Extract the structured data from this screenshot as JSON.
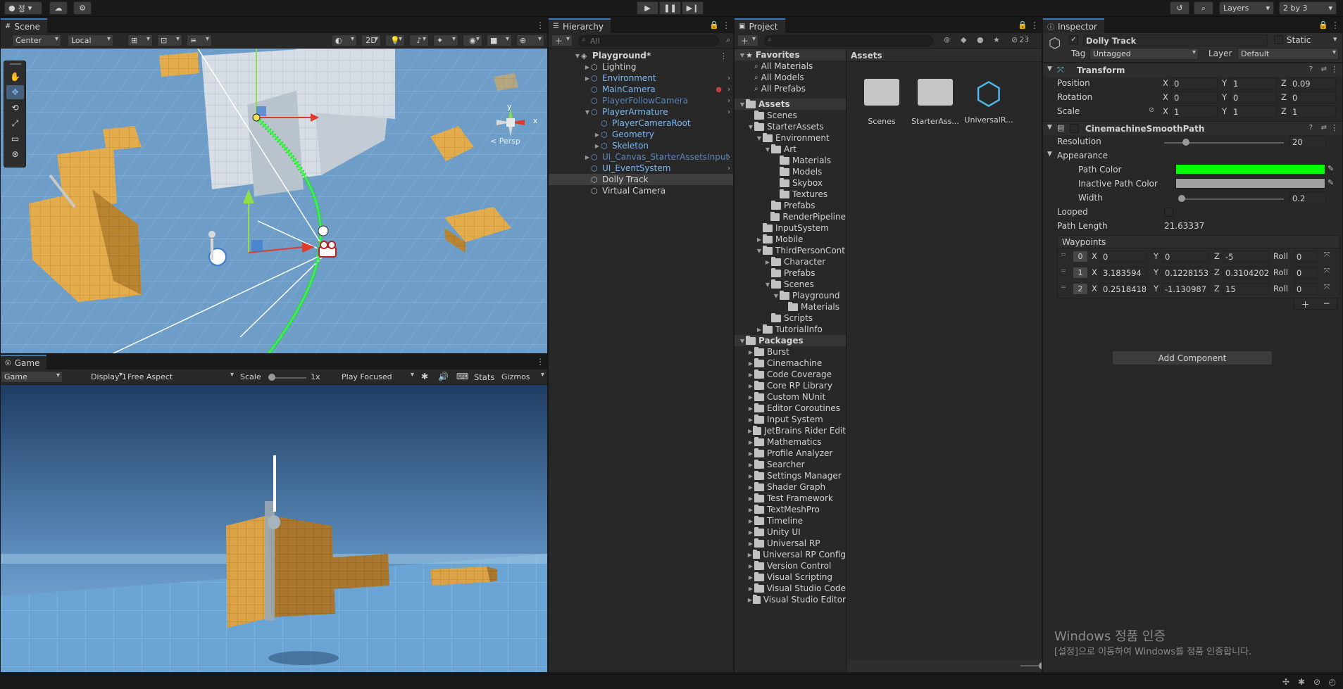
{
  "toolbar": {
    "account": "정",
    "layers": "Layers",
    "layout": "2 by 3"
  },
  "scene": {
    "tab": "Scene",
    "pivot": "Center",
    "space": "Local",
    "mode2d": "2D",
    "persp": "< Persp",
    "axis_y": "y",
    "axis_x": "x"
  },
  "game": {
    "tab": "Game",
    "mode": "Game",
    "display": "Display 1",
    "aspect": "Free Aspect",
    "scale_label": "Scale",
    "scale_value": "1x",
    "play_mode": "Play Focused",
    "stats": "Stats",
    "gizmos": "Gizmos"
  },
  "hierarchy": {
    "tab": "Hierarchy",
    "search_placeholder": "All",
    "items": [
      {
        "label": "Playground*",
        "indent": 0,
        "arrow": "▼",
        "style": "bold"
      },
      {
        "label": "Lighting",
        "indent": 1,
        "arrow": "▶",
        "style": "normal"
      },
      {
        "label": "Environment",
        "indent": 1,
        "arrow": "▶",
        "style": "blue"
      },
      {
        "label": "MainCamera",
        "indent": 1,
        "arrow": "",
        "style": "blue"
      },
      {
        "label": "PlayerFollowCamera",
        "indent": 1,
        "arrow": "",
        "style": "dim"
      },
      {
        "label": "PlayerArmature",
        "indent": 1,
        "arrow": "▼",
        "style": "blue"
      },
      {
        "label": "PlayerCameraRoot",
        "indent": 2,
        "arrow": "",
        "style": "blue"
      },
      {
        "label": "Geometry",
        "indent": 2,
        "arrow": "▶",
        "style": "blue"
      },
      {
        "label": "Skeleton",
        "indent": 2,
        "arrow": "▶",
        "style": "blue"
      },
      {
        "label": "UI_Canvas_StarterAssetsInput",
        "indent": 1,
        "arrow": "▶",
        "style": "dim"
      },
      {
        "label": "UI_EventSystem",
        "indent": 1,
        "arrow": "",
        "style": "blue"
      },
      {
        "label": "Dolly Track",
        "indent": 1,
        "arrow": "",
        "style": "selected"
      },
      {
        "label": "Virtual Camera",
        "indent": 1,
        "arrow": "",
        "style": "normal"
      }
    ]
  },
  "project": {
    "tab": "Project",
    "badge": "23",
    "favorites_label": "Favorites",
    "favorites": [
      "All Materials",
      "All Models",
      "All Prefabs"
    ],
    "assets_label": "Assets",
    "tree": [
      {
        "label": "Scenes",
        "indent": 1,
        "arrow": ""
      },
      {
        "label": "StarterAssets",
        "indent": 1,
        "arrow": "▼"
      },
      {
        "label": "Environment",
        "indent": 2,
        "arrow": "▼"
      },
      {
        "label": "Art",
        "indent": 3,
        "arrow": "▼"
      },
      {
        "label": "Materials",
        "indent": 4,
        "arrow": ""
      },
      {
        "label": "Models",
        "indent": 4,
        "arrow": ""
      },
      {
        "label": "Skybox",
        "indent": 4,
        "arrow": ""
      },
      {
        "label": "Textures",
        "indent": 4,
        "arrow": ""
      },
      {
        "label": "Prefabs",
        "indent": 3,
        "arrow": ""
      },
      {
        "label": "RenderPipeline",
        "indent": 3,
        "arrow": ""
      },
      {
        "label": "InputSystem",
        "indent": 2,
        "arrow": ""
      },
      {
        "label": "Mobile",
        "indent": 2,
        "arrow": "▶"
      },
      {
        "label": "ThirdPersonCont",
        "indent": 2,
        "arrow": "▼"
      },
      {
        "label": "Character",
        "indent": 3,
        "arrow": "▶"
      },
      {
        "label": "Prefabs",
        "indent": 3,
        "arrow": ""
      },
      {
        "label": "Scenes",
        "indent": 3,
        "arrow": "▼"
      },
      {
        "label": "Playground",
        "indent": 4,
        "arrow": "▼"
      },
      {
        "label": "Materials",
        "indent": 5,
        "arrow": ""
      },
      {
        "label": "Scripts",
        "indent": 3,
        "arrow": ""
      },
      {
        "label": "TutorialInfo",
        "indent": 2,
        "arrow": "▶"
      }
    ],
    "packages_label": "Packages",
    "packages": [
      "Burst",
      "Cinemachine",
      "Code Coverage",
      "Core RP Library",
      "Custom NUnit",
      "Editor Coroutines",
      "Input System",
      "JetBrains Rider Edit",
      "Mathematics",
      "Profile Analyzer",
      "Searcher",
      "Settings Manager",
      "Shader Graph",
      "Test Framework",
      "TextMeshPro",
      "Timeline",
      "Unity UI",
      "Universal RP",
      "Universal RP Config",
      "Version Control",
      "Visual Scripting",
      "Visual Studio Code",
      "Visual Studio Editor"
    ],
    "grid_header": "Assets",
    "grid_items": [
      {
        "label": "Scenes",
        "kind": "folder"
      },
      {
        "label": "StarterAss...",
        "kind": "folder"
      },
      {
        "label": "UniversalR...",
        "kind": "asset"
      }
    ]
  },
  "inspector": {
    "tab": "Inspector",
    "object_name": "Dolly Track",
    "static_label": "Static",
    "tag_label": "Tag",
    "tag_value": "Untagged",
    "layer_label": "Layer",
    "layer_value": "Default",
    "transform": {
      "title": "Transform",
      "rows": [
        {
          "label": "Position",
          "x": "0",
          "y": "1",
          "z": "0.09"
        },
        {
          "label": "Rotation",
          "x": "0",
          "y": "0",
          "z": "0"
        },
        {
          "label": "Scale",
          "x": "1",
          "y": "1",
          "z": "1"
        }
      ]
    },
    "smooth_path": {
      "title": "CinemachineSmoothPath",
      "resolution_label": "Resolution",
      "resolution_value": "20",
      "resolution_fraction": 0.16,
      "appearance_label": "Appearance",
      "path_color_label": "Path Color",
      "path_color": "#00ff00",
      "inactive_color_label": "Inactive Path Color",
      "inactive_color": "#a0a0a0",
      "width_label": "Width",
      "width_value": "0.2",
      "width_fraction": 0.0,
      "looped_label": "Looped",
      "path_length_label": "Path Length",
      "path_length_value": "21.63337",
      "waypoints_label": "Waypoints",
      "roll_label": "Roll",
      "waypoints": [
        {
          "index": "0",
          "x": "0",
          "y": "0",
          "z": "-5",
          "roll": "0"
        },
        {
          "index": "1",
          "x": "3.183594",
          "y": "0.1228153",
          "z": "0.3104202",
          "roll": "0"
        },
        {
          "index": "2",
          "x": "0.2518418",
          "y": "-1.130987",
          "z": "15",
          "roll": "0"
        }
      ]
    },
    "add_component": "Add Component"
  },
  "watermark": {
    "line1": "Windows 정품 인증",
    "line2": "[설정]으로 이동하여 Windows를 정품 인증합니다."
  },
  "colors": {
    "accent": "#3a79bb",
    "panel": "#282828",
    "selection": "#3e3e3e",
    "box": "#e0a94a"
  }
}
